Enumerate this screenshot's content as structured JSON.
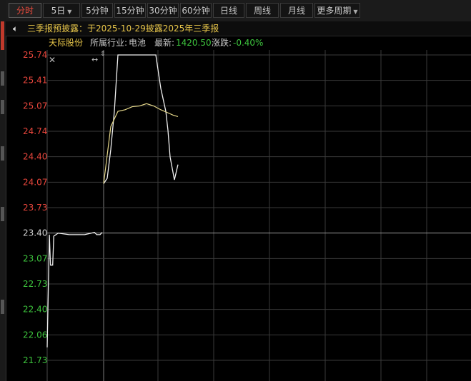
{
  "toolbar": {
    "tabs": [
      {
        "label": "分时",
        "active": true,
        "dropdown": false
      },
      {
        "label": "5日",
        "active": false,
        "dropdown": true
      },
      {
        "label": "5分钟",
        "active": false,
        "dropdown": false
      },
      {
        "label": "15分钟",
        "active": false,
        "dropdown": false
      },
      {
        "label": "30分钟",
        "active": false,
        "dropdown": false
      },
      {
        "label": "60分钟",
        "active": false,
        "dropdown": false
      },
      {
        "label": "日线",
        "active": false,
        "dropdown": false
      },
      {
        "label": "周线",
        "active": false,
        "dropdown": false
      },
      {
        "label": "月线",
        "active": false,
        "dropdown": false
      },
      {
        "label": "更多周期",
        "active": false,
        "dropdown": true
      }
    ]
  },
  "notice": {
    "icon": "speaker-icon",
    "text": "三季报预披露：于2025-10-29披露2025年三季报"
  },
  "info": {
    "stock_name": "天际股份",
    "industry_label": "所属行业:",
    "industry_value": "电池",
    "latest_label": "最新:",
    "latest_value": "1420.50",
    "change_label": "涨跌:",
    "change_value": "-0.40%"
  },
  "colors": {
    "up": "#e8463c",
    "down": "#3dc43d",
    "neutral": "#d0d0d0",
    "price_line": "#f0f0f0",
    "avg_line": "#e6d88a",
    "grid": "#3a3a3a",
    "notice": "#e8c64a"
  },
  "chart_data": {
    "type": "line",
    "y_ticks": [
      "25.74",
      "25.41",
      "25.07",
      "24.74",
      "24.40",
      "24.07",
      "23.73",
      "23.40",
      "23.07",
      "22.73",
      "22.40",
      "22.06",
      "21.73"
    ],
    "reference_price": 23.4,
    "ylim": [
      21.73,
      25.74
    ],
    "series": [
      {
        "role": "price",
        "x": [
          0,
          2,
          3,
          5,
          6,
          10,
          20,
          34,
          43,
          45,
          48,
          50,
          51,
          55,
          62,
          70,
          78,
          82,
          88,
          95,
          100,
          101,
          103,
          112,
          115,
          120,
          131,
          132,
          133
        ],
        "y": [
          21.9,
          23.38,
          22.98,
          22.98,
          23.36,
          23.4,
          23.38,
          23.38,
          23.41,
          23.38,
          23.38,
          23.41,
          24.05,
          24.12,
          25.0,
          25.74,
          25.74,
          25.74,
          25.74,
          25.74,
          25.74,
          25.74,
          25.74,
          25.7,
          25.0,
          24.75,
          24.35,
          24.05,
          24.0
        ],
        "note_values": [
          24.05,
          24.12,
          24.5,
          25.0,
          25.74,
          25.74,
          25.74,
          25.74,
          25.74,
          25.74,
          25.3,
          25.0,
          24.75,
          24.4,
          24.1,
          24.3,
          24.1,
          23.5
        ]
      },
      {
        "role": "average",
        "x": [
          78,
          82,
          90,
          100,
          110,
          120,
          130,
          140,
          150,
          160,
          170,
          180
        ],
        "y": [
          24.05,
          24.8,
          25.0,
          25.02,
          25.06,
          25.07,
          25.1,
          25.07,
          25.02,
          24.98,
          24.95,
          24.93
        ]
      }
    ],
    "grid": true
  }
}
